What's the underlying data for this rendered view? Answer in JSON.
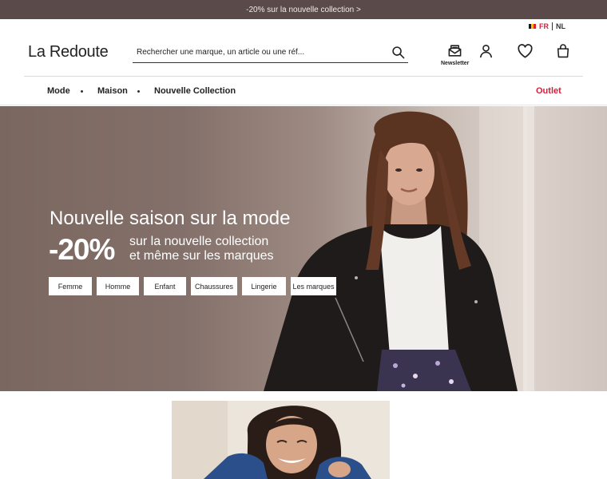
{
  "promo": {
    "text": "-20% sur la nouvelle collection >"
  },
  "header": {
    "logo": "La Redoute",
    "lang": {
      "current": "FR",
      "other": "NL"
    },
    "search": {
      "placeholder": "Rechercher une marque, un article ou une réf..."
    },
    "newsletter_label": "Newsletter"
  },
  "nav": {
    "items": [
      "Mode",
      "Maison",
      "Nouvelle Collection"
    ],
    "outlet": "Outlet"
  },
  "hero": {
    "title": "Nouvelle saison sur la mode",
    "discount": "-20%",
    "sub_line1": "sur la nouvelle collection",
    "sub_line2": "et même sur les marques",
    "buttons": [
      "Femme",
      "Homme",
      "Enfant",
      "Chaussures",
      "Lingerie",
      "Les marques"
    ]
  },
  "colors": {
    "promo_bg": "#5a4a4a",
    "accent_red": "#d6203a",
    "hero_bg": "#84706a"
  },
  "icons": [
    "search-icon",
    "newsletter-icon",
    "account-icon",
    "heart-icon",
    "bag-icon"
  ]
}
